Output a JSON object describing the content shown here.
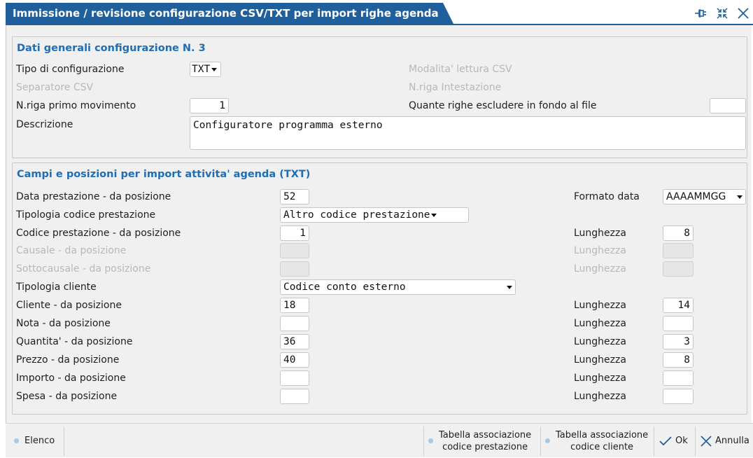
{
  "window": {
    "title": "Immissione / revisione configurazione CSV/TXT per import righe agenda"
  },
  "title_controls": [
    {
      "name": "pin-icon"
    },
    {
      "name": "collapse-icon"
    },
    {
      "name": "close-icon"
    }
  ],
  "general": {
    "title": "Dati generali configurazione N. 3",
    "tipo_config_label": "Tipo di configurazione",
    "tipo_config_value": "TXT",
    "modalita_label": "Modalita' lettura CSV",
    "separatore_label": "Separatore CSV",
    "nriga_intest_label": "N.riga Intestazione",
    "nriga_primo_label": "N.riga primo movimento",
    "nriga_primo_value": "1",
    "righe_escludere_label": "Quante righe escludere in fondo al file",
    "righe_escludere_value": "",
    "descrizione_label": "Descrizione",
    "descrizione_value": "Configuratore programma esterno"
  },
  "fields": {
    "title": "Campi e posizioni per import attivita' agenda (TXT)",
    "data_prest_label": "Data prestazione - da posizione",
    "data_prest_value": "52",
    "formato_data_label": "Formato data",
    "formato_data_value": "AAAAMMGG",
    "tipologia_cod_label": "Tipologia codice prestazione",
    "tipologia_cod_value": "Altro codice prestazione",
    "cod_prest_label": "Codice prestazione - da posizione",
    "cod_prest_value": "1",
    "cod_prest_len_label": "Lunghezza",
    "cod_prest_len_value": "8",
    "causale_label": "Causale - da posizione",
    "causale_len_label": "Lunghezza",
    "sottocausale_label": "Sottocausale - da posizione",
    "sottocausale_len_label": "Lunghezza",
    "tipologia_cliente_label": "Tipologia cliente",
    "tipologia_cliente_value": "Codice conto esterno",
    "cliente_label": "Cliente - da posizione",
    "cliente_value": "18",
    "cliente_len_label": "Lunghezza",
    "cliente_len_value": "14",
    "nota_label": "Nota - da posizione",
    "nota_value": "",
    "nota_len_label": "Lunghezza",
    "nota_len_value": "",
    "quantita_label": "Quantita' - da posizione",
    "quantita_value": "36",
    "quantita_len_label": "Lunghezza",
    "quantita_len_value": "3",
    "prezzo_label": "Prezzo - da posizione",
    "prezzo_value": "40",
    "prezzo_len_label": "Lunghezza",
    "prezzo_len_value": "8",
    "importo_label": "Importo - da posizione",
    "importo_value": "",
    "importo_len_label": "Lunghezza",
    "importo_len_value": "",
    "spesa_label": "Spesa - da posizione",
    "spesa_value": "",
    "spesa_len_label": "Lunghezza",
    "spesa_len_value": ""
  },
  "footer": {
    "elenco": "Elenco",
    "tab_prest_l1": "Tabella associazione",
    "tab_prest_l2": "codice prestazione",
    "tab_cli_l1": "Tabella associazione",
    "tab_cli_l2": "codice cliente",
    "ok": "Ok",
    "annulla": "Annulla"
  },
  "colors": {
    "accent": "#1f5f9b",
    "section_title": "#1f6eb5",
    "panel_bg": "#f0f0f0"
  }
}
